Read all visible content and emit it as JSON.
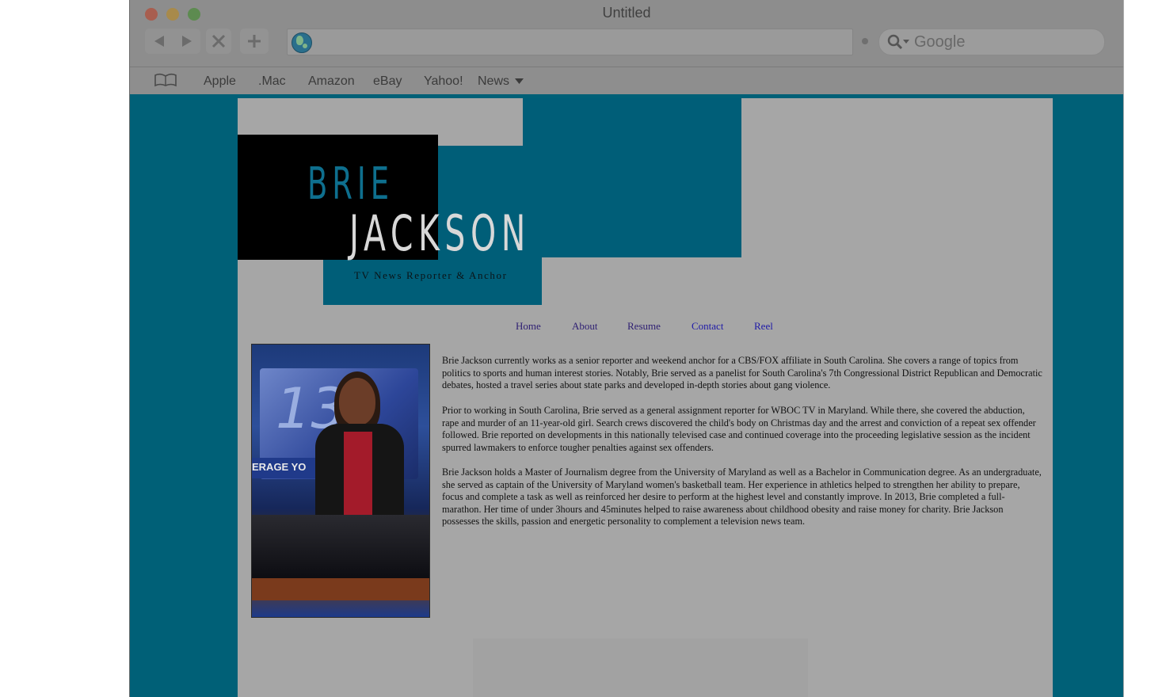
{
  "browser": {
    "title": "Untitled",
    "url_value": "",
    "search_placeholder": "Google",
    "bookmarks": [
      "Apple",
      ".Mac",
      "Amazon",
      "eBay",
      "Yahoo!",
      "News"
    ]
  },
  "site": {
    "logo_first": "BRIE",
    "logo_last": "JACKSON",
    "tagline": "TV News Reporter & Anchor",
    "nav": [
      "Home",
      "About",
      "Resume",
      "Contact",
      "Reel"
    ],
    "photo_text": "ERAGE YO",
    "bio": [
      "Brie Jackson currently works as a senior reporter and weekend anchor for a CBS/FOX affiliate in South Carolina. She covers a range of topics from politics to sports and human interest stories. Notably, Brie served as a panelist for South Carolina's 7th Congressional District Republican and Democratic debates, hosted a travel series about state parks and developed in-depth stories about gang violence.",
      "Prior to working in South Carolina, Brie served as a general assignment reporter for WBOC TV in Maryland. While there, she covered the abduction, rape and murder of an 11-year-old girl. Search crews discovered the child's body on Christmas day and the arrest and conviction of a repeat sex offender followed. Brie reported on developments in this nationally televised case and continued coverage into the proceeding legislative session as the incident spurred lawmakers to enforce tougher penalties against sex offenders.",
      "Brie Jackson holds a Master of Journalism degree from the University of Maryland as well as a Bachelor in Communication degree. As an undergraduate, she served as captain of the University of Maryland women's basketball team. Her experience in athletics helped to strengthen her ability to prepare, focus and complete a task as well as reinforced her desire to perform at the highest level and constantly improve. In 2013, Brie completed a full-marathon. Her time of under 3hours and 45minutes helped to raise awareness about childhood obesity and raise money for charity. Brie Jackson possesses the skills, passion and energetic personality to complement a television news team."
    ]
  },
  "colors": {
    "page_background": "#006077",
    "content_background": "#a6a6a6",
    "accent_blue": "#005e78"
  },
  "icons": [
    "back-arrow-icon",
    "forward-arrow-icon",
    "stop-icon",
    "add-icon",
    "globe-icon",
    "search-icon",
    "bookmarks-book-icon",
    "dropdown-triangle-icon"
  ]
}
